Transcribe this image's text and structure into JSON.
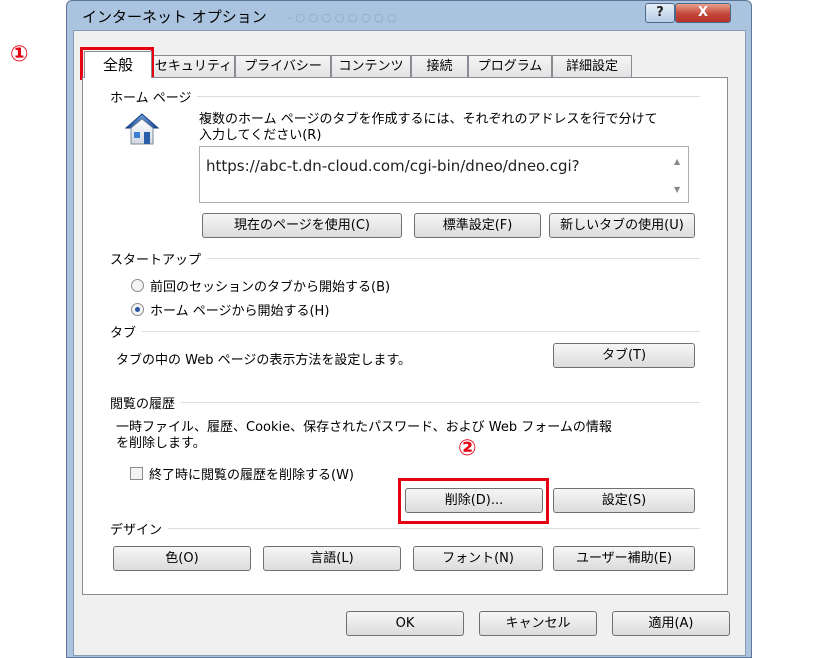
{
  "window": {
    "title": "インターネット オプション",
    "help_glyph": "?",
    "close_glyph": "X",
    "behind_tab_text": "- ○ ○ ○ ○ ○ ○ ○ ○"
  },
  "tabs": [
    {
      "label": "全般"
    },
    {
      "label": "セキュリティ"
    },
    {
      "label": "プライバシー"
    },
    {
      "label": "コンテンツ"
    },
    {
      "label": "接続"
    },
    {
      "label": "プログラム"
    },
    {
      "label": "詳細設定"
    }
  ],
  "home_page": {
    "group_label": "ホーム ページ",
    "description_line1": "複数のホーム ページのタブを作成するには、それぞれのアドレスを行で分けて",
    "description_line2": "入力してください(R)",
    "url": "https://abc-t.dn-cloud.com/cgi-bin/dneo/dneo.cgi?",
    "btn_current": "現在のページを使用(C)",
    "btn_default": "標準設定(F)",
    "btn_newtab": "新しいタブの使用(U)"
  },
  "startup": {
    "group_label": "スタートアップ",
    "option_session": "前回のセッションのタブから開始する(B)",
    "option_home": "ホーム ページから開始する(H)",
    "selected": "home"
  },
  "tabs_section": {
    "group_label": "タブ",
    "description": "タブの中の Web ページの表示方法を設定します。",
    "btn_tabs": "タブ(T)"
  },
  "history": {
    "group_label": "閲覧の履歴",
    "description_line1": "一時ファイル、履歴、Cookie、保存されたパスワード、および Web フォームの情報",
    "description_line2": "を削除します。",
    "checkbox_label": "終了時に閲覧の履歴を削除する(W)",
    "checkbox_checked": false,
    "btn_delete": "削除(D)...",
    "btn_settings": "設定(S)"
  },
  "design": {
    "group_label": "デザイン",
    "btn_colors": "色(O)",
    "btn_languages": "言語(L)",
    "btn_fonts": "フォント(N)",
    "btn_accessibility": "ユーザー補助(E)"
  },
  "footer": {
    "btn_ok": "OK",
    "btn_cancel": "キャンセル",
    "btn_apply": "適用(A)"
  },
  "annotations": {
    "marker1": "①",
    "marker2": "②",
    "color": "#e60012"
  }
}
